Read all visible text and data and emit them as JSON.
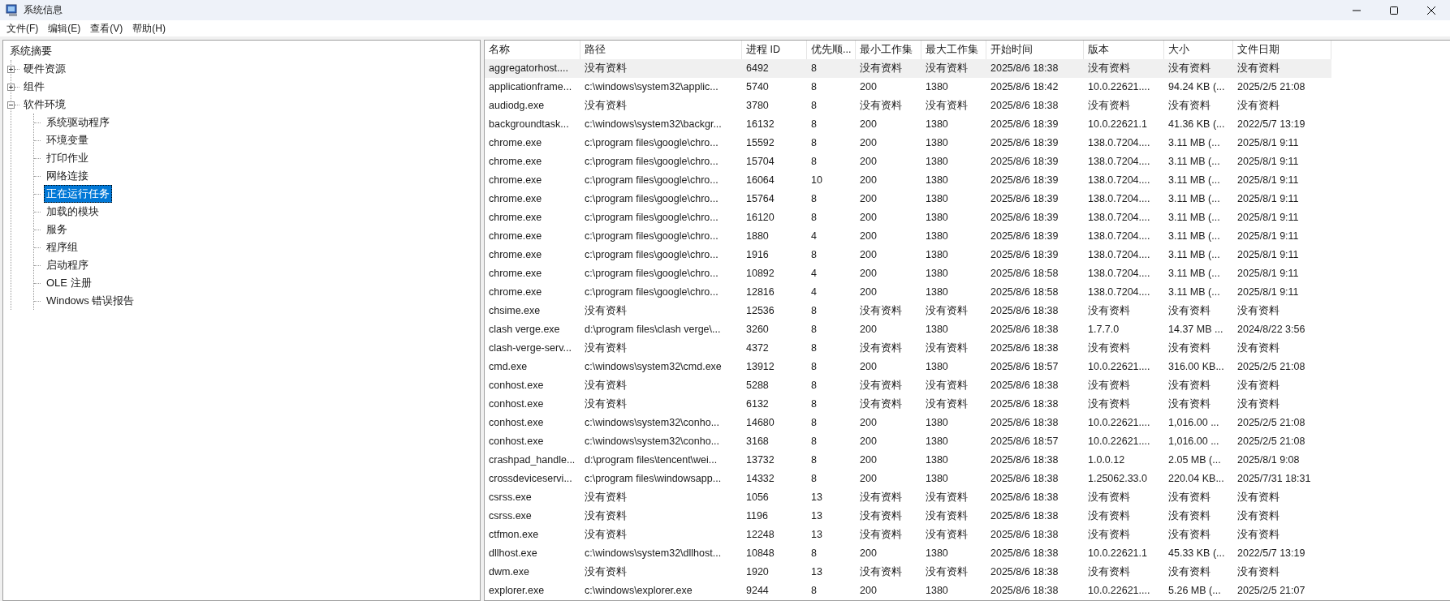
{
  "window": {
    "title": "系统信息"
  },
  "menu": [
    "文件(F)",
    "编辑(E)",
    "查看(V)",
    "帮助(H)"
  ],
  "tree": [
    {
      "label": "系统摘要",
      "selected": false,
      "children": [
        {
          "label": "硬件资源",
          "expanded": false,
          "selected": false
        },
        {
          "label": "组件",
          "expanded": false,
          "selected": false
        },
        {
          "label": "软件环境",
          "expanded": true,
          "selected": false,
          "children": [
            {
              "label": "系统驱动程序",
              "selected": false
            },
            {
              "label": "环境变量",
              "selected": false
            },
            {
              "label": "打印作业",
              "selected": false
            },
            {
              "label": "网络连接",
              "selected": false
            },
            {
              "label": "正在运行任务",
              "selected": true
            },
            {
              "label": "加载的模块",
              "selected": false
            },
            {
              "label": "服务",
              "selected": false
            },
            {
              "label": "程序组",
              "selected": false
            },
            {
              "label": "启动程序",
              "selected": false
            },
            {
              "label": "OLE 注册",
              "selected": false
            },
            {
              "label": "Windows 错误报告",
              "selected": false
            }
          ]
        }
      ]
    }
  ],
  "table": {
    "columns": [
      "名称",
      "路径",
      "进程 ID",
      "优先顺...",
      "最小工作集",
      "最大工作集",
      "开始时间",
      "版本",
      "大小",
      "文件日期"
    ],
    "rows": [
      {
        "selected": true,
        "cells": [
          "aggregatorhost....",
          "没有资料",
          "6492",
          "8",
          "没有资料",
          "没有资料",
          "2025/8/6 18:38",
          "没有资料",
          "没有资料",
          "没有资料"
        ]
      },
      {
        "selected": false,
        "cells": [
          "applicationframe...",
          "c:\\windows\\system32\\applic...",
          "5740",
          "8",
          "200",
          "1380",
          "2025/8/6 18:42",
          "10.0.22621....",
          "94.24 KB (...",
          "2025/2/5 21:08"
        ]
      },
      {
        "selected": false,
        "cells": [
          "audiodg.exe",
          "没有资料",
          "3780",
          "8",
          "没有资料",
          "没有资料",
          "2025/8/6 18:38",
          "没有资料",
          "没有资料",
          "没有资料"
        ]
      },
      {
        "selected": false,
        "cells": [
          "backgroundtask...",
          "c:\\windows\\system32\\backgr...",
          "16132",
          "8",
          "200",
          "1380",
          "2025/8/6 18:39",
          "10.0.22621.1",
          "41.36 KB (...",
          "2022/5/7 13:19"
        ]
      },
      {
        "selected": false,
        "cells": [
          "chrome.exe",
          "c:\\program files\\google\\chro...",
          "15592",
          "8",
          "200",
          "1380",
          "2025/8/6 18:39",
          "138.0.7204....",
          "3.11 MB (...",
          "2025/8/1 9:11"
        ]
      },
      {
        "selected": false,
        "cells": [
          "chrome.exe",
          "c:\\program files\\google\\chro...",
          "15704",
          "8",
          "200",
          "1380",
          "2025/8/6 18:39",
          "138.0.7204....",
          "3.11 MB (...",
          "2025/8/1 9:11"
        ]
      },
      {
        "selected": false,
        "cells": [
          "chrome.exe",
          "c:\\program files\\google\\chro...",
          "16064",
          "10",
          "200",
          "1380",
          "2025/8/6 18:39",
          "138.0.7204....",
          "3.11 MB (...",
          "2025/8/1 9:11"
        ]
      },
      {
        "selected": false,
        "cells": [
          "chrome.exe",
          "c:\\program files\\google\\chro...",
          "15764",
          "8",
          "200",
          "1380",
          "2025/8/6 18:39",
          "138.0.7204....",
          "3.11 MB (...",
          "2025/8/1 9:11"
        ]
      },
      {
        "selected": false,
        "cells": [
          "chrome.exe",
          "c:\\program files\\google\\chro...",
          "16120",
          "8",
          "200",
          "1380",
          "2025/8/6 18:39",
          "138.0.7204....",
          "3.11 MB (...",
          "2025/8/1 9:11"
        ]
      },
      {
        "selected": false,
        "cells": [
          "chrome.exe",
          "c:\\program files\\google\\chro...",
          "1880",
          "4",
          "200",
          "1380",
          "2025/8/6 18:39",
          "138.0.7204....",
          "3.11 MB (...",
          "2025/8/1 9:11"
        ]
      },
      {
        "selected": false,
        "cells": [
          "chrome.exe",
          "c:\\program files\\google\\chro...",
          "1916",
          "8",
          "200",
          "1380",
          "2025/8/6 18:39",
          "138.0.7204....",
          "3.11 MB (...",
          "2025/8/1 9:11"
        ]
      },
      {
        "selected": false,
        "cells": [
          "chrome.exe",
          "c:\\program files\\google\\chro...",
          "10892",
          "4",
          "200",
          "1380",
          "2025/8/6 18:58",
          "138.0.7204....",
          "3.11 MB (...",
          "2025/8/1 9:11"
        ]
      },
      {
        "selected": false,
        "cells": [
          "chrome.exe",
          "c:\\program files\\google\\chro...",
          "12816",
          "4",
          "200",
          "1380",
          "2025/8/6 18:58",
          "138.0.7204....",
          "3.11 MB (...",
          "2025/8/1 9:11"
        ]
      },
      {
        "selected": false,
        "cells": [
          "chsime.exe",
          "没有资料",
          "12536",
          "8",
          "没有资料",
          "没有资料",
          "2025/8/6 18:38",
          "没有资料",
          "没有资料",
          "没有资料"
        ]
      },
      {
        "selected": false,
        "cells": [
          "clash verge.exe",
          "d:\\program files\\clash verge\\...",
          "3260",
          "8",
          "200",
          "1380",
          "2025/8/6 18:38",
          "1.7.7.0",
          "14.37 MB ...",
          "2024/8/22 3:56"
        ]
      },
      {
        "selected": false,
        "cells": [
          "clash-verge-serv...",
          "没有资料",
          "4372",
          "8",
          "没有资料",
          "没有资料",
          "2025/8/6 18:38",
          "没有资料",
          "没有资料",
          "没有资料"
        ]
      },
      {
        "selected": false,
        "cells": [
          "cmd.exe",
          "c:\\windows\\system32\\cmd.exe",
          "13912",
          "8",
          "200",
          "1380",
          "2025/8/6 18:57",
          "10.0.22621....",
          "316.00 KB...",
          "2025/2/5 21:08"
        ]
      },
      {
        "selected": false,
        "cells": [
          "conhost.exe",
          "没有资料",
          "5288",
          "8",
          "没有资料",
          "没有资料",
          "2025/8/6 18:38",
          "没有资料",
          "没有资料",
          "没有资料"
        ]
      },
      {
        "selected": false,
        "cells": [
          "conhost.exe",
          "没有资料",
          "6132",
          "8",
          "没有资料",
          "没有资料",
          "2025/8/6 18:38",
          "没有资料",
          "没有资料",
          "没有资料"
        ]
      },
      {
        "selected": false,
        "cells": [
          "conhost.exe",
          "c:\\windows\\system32\\conho...",
          "14680",
          "8",
          "200",
          "1380",
          "2025/8/6 18:38",
          "10.0.22621....",
          "1,016.00 ...",
          "2025/2/5 21:08"
        ]
      },
      {
        "selected": false,
        "cells": [
          "conhost.exe",
          "c:\\windows\\system32\\conho...",
          "3168",
          "8",
          "200",
          "1380",
          "2025/8/6 18:57",
          "10.0.22621....",
          "1,016.00 ...",
          "2025/2/5 21:08"
        ]
      },
      {
        "selected": false,
        "cells": [
          "crashpad_handle...",
          "d:\\program files\\tencent\\wei...",
          "13732",
          "8",
          "200",
          "1380",
          "2025/8/6 18:38",
          "1.0.0.12",
          "2.05 MB (...",
          "2025/8/1 9:08"
        ]
      },
      {
        "selected": false,
        "cells": [
          "crossdeviceservi...",
          "c:\\program files\\windowsapp...",
          "14332",
          "8",
          "200",
          "1380",
          "2025/8/6 18:38",
          "1.25062.33.0",
          "220.04 KB...",
          "2025/7/31 18:31"
        ]
      },
      {
        "selected": false,
        "cells": [
          "csrss.exe",
          "没有资料",
          "1056",
          "13",
          "没有资料",
          "没有资料",
          "2025/8/6 18:38",
          "没有资料",
          "没有资料",
          "没有资料"
        ]
      },
      {
        "selected": false,
        "cells": [
          "csrss.exe",
          "没有资料",
          "1196",
          "13",
          "没有资料",
          "没有资料",
          "2025/8/6 18:38",
          "没有资料",
          "没有资料",
          "没有资料"
        ]
      },
      {
        "selected": false,
        "cells": [
          "ctfmon.exe",
          "没有资料",
          "12248",
          "13",
          "没有资料",
          "没有资料",
          "2025/8/6 18:38",
          "没有资料",
          "没有资料",
          "没有资料"
        ]
      },
      {
        "selected": false,
        "cells": [
          "dllhost.exe",
          "c:\\windows\\system32\\dllhost...",
          "10848",
          "8",
          "200",
          "1380",
          "2025/8/6 18:38",
          "10.0.22621.1",
          "45.33 KB (...",
          "2022/5/7 13:19"
        ]
      },
      {
        "selected": false,
        "cells": [
          "dwm.exe",
          "没有资料",
          "1920",
          "13",
          "没有资料",
          "没有资料",
          "2025/8/6 18:38",
          "没有资料",
          "没有资料",
          "没有资料"
        ]
      },
      {
        "selected": false,
        "cells": [
          "explorer.exe",
          "c:\\windows\\explorer.exe",
          "9244",
          "8",
          "200",
          "1380",
          "2025/8/6 18:38",
          "10.0.22621....",
          "5.26 MB (...",
          "2025/2/5 21:07"
        ]
      }
    ]
  }
}
